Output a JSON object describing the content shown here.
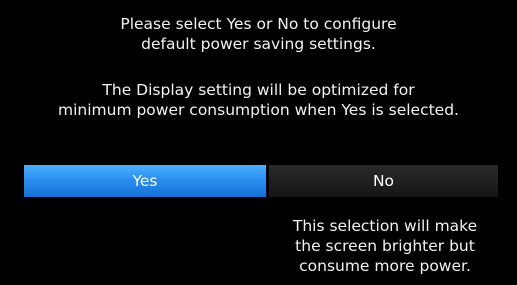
{
  "dialog": {
    "message_1": [
      "Please select Yes or No to configure",
      "default power saving settings."
    ],
    "message_2": [
      "The Display setting will be optimized for",
      "minimum power consumption when Yes is selected."
    ],
    "options": {
      "yes_label": "Yes",
      "no_label": "No",
      "selected": "Yes"
    },
    "hint": [
      "This selection will make",
      "the screen brighter but",
      "consume more power."
    ]
  },
  "colors": {
    "background": "#000000",
    "selected_accent": "#2b8ff0",
    "unselected_button": "#202020",
    "text": "#ffffff"
  }
}
